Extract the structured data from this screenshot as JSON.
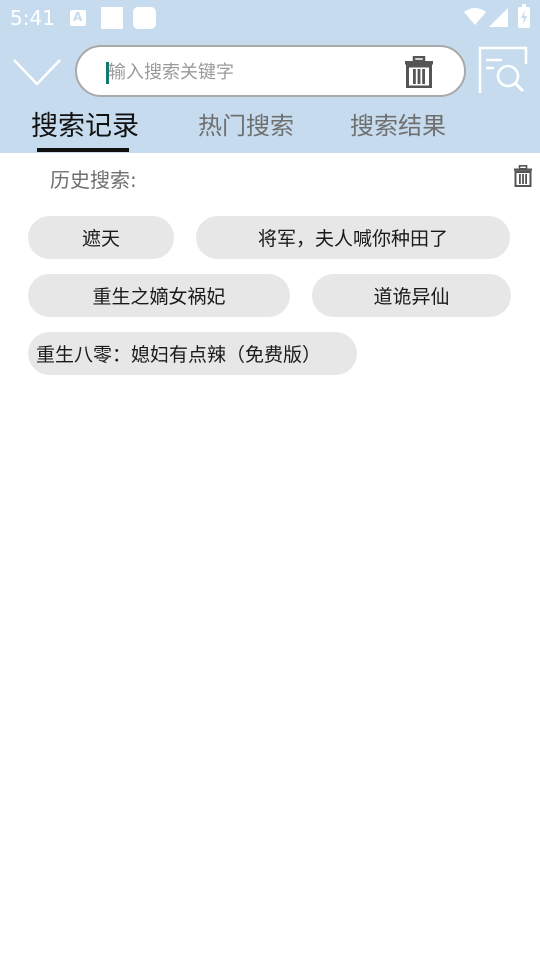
{
  "status_bar": {
    "time": "5:41",
    "notification_icons": [
      "app-a-icon",
      "square-icon",
      "rounded-square-icon"
    ],
    "system_icons": [
      "wifi-icon",
      "signal-icon",
      "battery-charging-icon"
    ]
  },
  "search": {
    "placeholder": "输入搜索关键字",
    "value": ""
  },
  "tabs": [
    {
      "label": "搜索记录",
      "active": true
    },
    {
      "label": "热门搜索",
      "active": false
    },
    {
      "label": "搜索结果",
      "active": false
    }
  ],
  "history": {
    "title": "历史搜索:",
    "items": [
      "遮天",
      "将军，夫人喊你种田了",
      "重生之嫡女祸妃",
      "道诡异仙",
      "重生八零：媳妇有点辣（免费版）"
    ]
  },
  "colors": {
    "header_bg": "#c6dcee",
    "tag_bg": "#e7e7e7",
    "tab_active": "#111111",
    "tab_inactive": "#6f6f6f",
    "cursor": "#127a6a"
  }
}
